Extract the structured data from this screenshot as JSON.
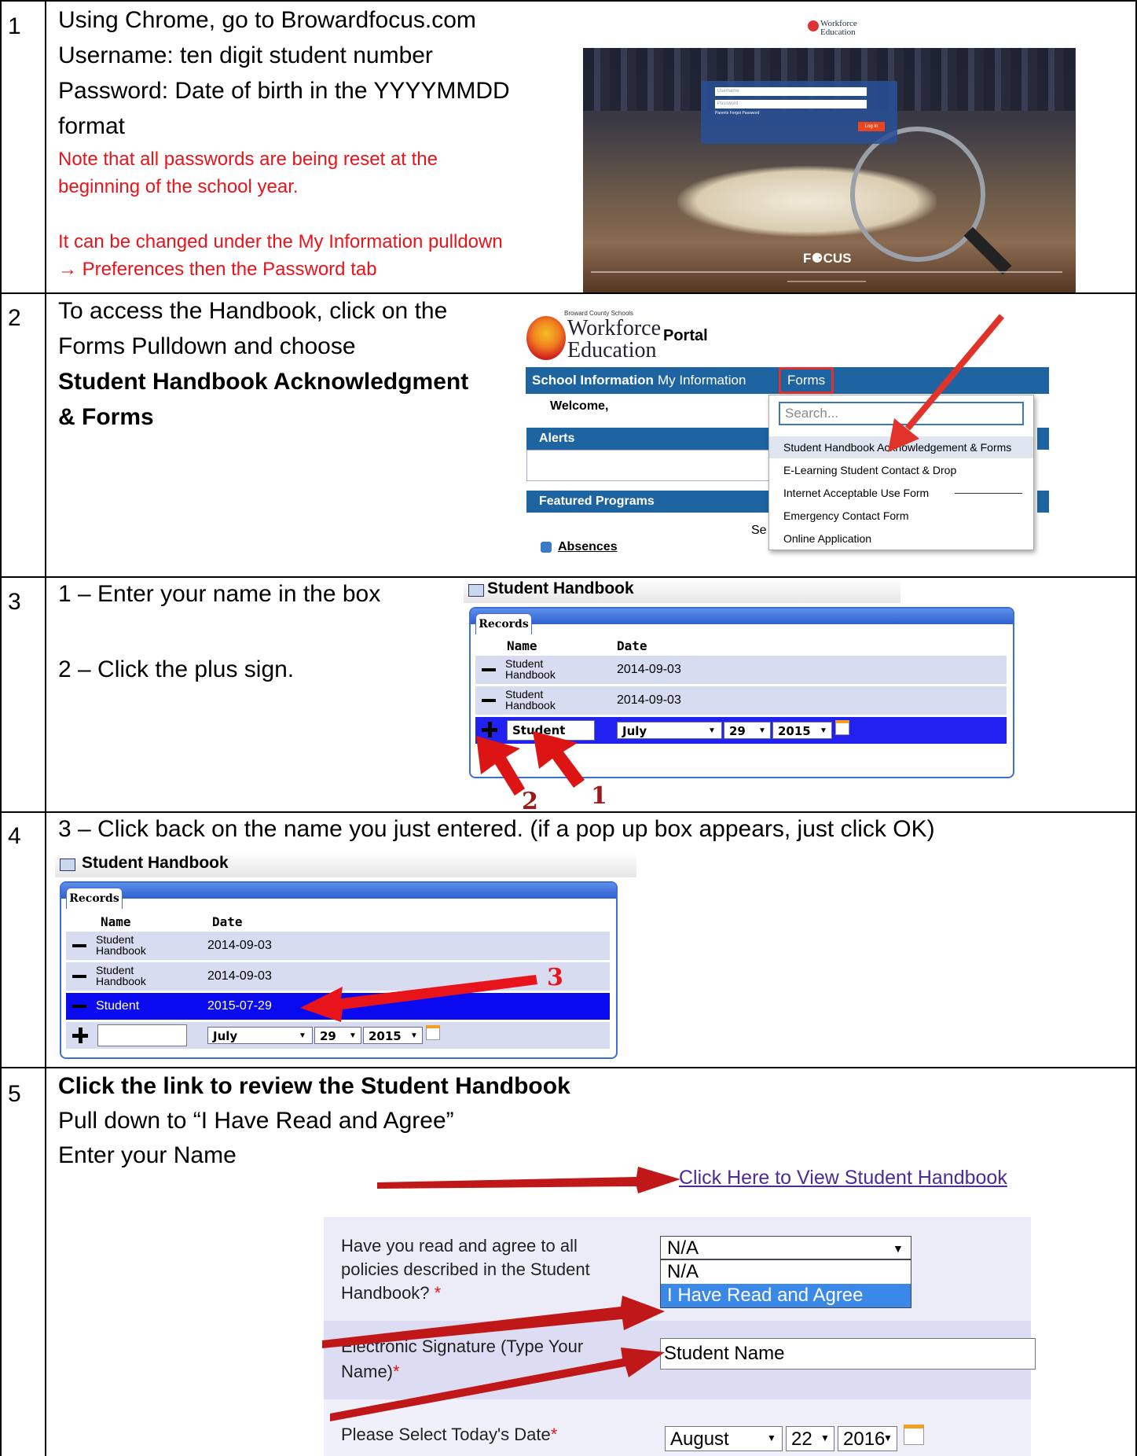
{
  "steps": [
    {
      "number": "1"
    },
    {
      "number": "2"
    },
    {
      "number": "3"
    },
    {
      "number": "4"
    },
    {
      "number": "5"
    }
  ],
  "step1": {
    "line1": "Using Chrome, go to Browardfocus.com",
    "line2": "Username: ten digit student number",
    "line3": "Password: Date of birth in the YYYYMMDD",
    "line4": "format",
    "note1": "Note that all passwords are being reset at the",
    "note2": "beginning of the school year.",
    "note3": "It can be changed under the My Information pulldown",
    "note4": "→ Preferences then the Password tab",
    "login": {
      "logo1": "Workforce",
      "logo2": "Education",
      "username_placeholder": "Username",
      "password_placeholder": "Password",
      "forgot": "Parents Forgot Password",
      "login_button": "Log In",
      "brand": "F⚈CUS"
    }
  },
  "step2": {
    "line1": "To access the Handbook, click on the",
    "line2": "Forms Pulldown and choose",
    "bold1": "Student Handbook Acknowledgment",
    "bold2": "& Forms",
    "portal": {
      "org": "Broward County Schools",
      "logo1": "Workforce",
      "logo2": "Education",
      "portal_label": "Portal",
      "nav": [
        "School Information",
        "My Information",
        "Forms"
      ],
      "welcome": "Welcome,",
      "alerts": "Alerts",
      "featured": "Featured Programs",
      "absences": "Absences",
      "partial": "Se",
      "search_placeholder": "Search...",
      "menu": [
        "Student Handbook Acknowledgement & Forms",
        "E-Learning Student Contact & Drop",
        "Internet Acceptable Use Form",
        "Emergency Contact Form",
        "Online Application"
      ]
    }
  },
  "step3": {
    "line1": "1 – Enter your name in the box",
    "line2": "2 – Click the plus sign.",
    "title": "Student Handbook",
    "tab": "Records",
    "col_name": "Name",
    "col_date": "Date",
    "rows": [
      {
        "name1": "Student",
        "name2": "Handbook",
        "date": "2014-09-03"
      },
      {
        "name1": "Student",
        "name2": "Handbook",
        "date": "2014-09-03"
      }
    ],
    "input_value": "Student",
    "month": "July",
    "day": "29",
    "year": "2015",
    "marker1": "1",
    "marker2": "2"
  },
  "step4": {
    "line1": "3 – Click back on the name you just entered.  (if a pop up box appears, just click OK)",
    "title": "Student Handbook",
    "tab": "Records",
    "col_name": "Name",
    "col_date": "Date",
    "rows": [
      {
        "name1": "Student",
        "name2": "Handbook",
        "date": "2014-09-03"
      },
      {
        "name1": "Student",
        "name2": "Handbook",
        "date": "2014-09-03"
      }
    ],
    "selected_name": "Student",
    "selected_date": "2015-07-29",
    "month": "July",
    "day": "29",
    "year": "2015",
    "marker3": "3"
  },
  "step5": {
    "bold1": "Click the link to review the Student Handbook",
    "line2": "Pull down to “I Have Read and Agree”",
    "line3": "Enter your Name",
    "link": "Click Here to View Student Handbook",
    "q1a": "Have you read and agree to all",
    "q1b": "policies described in the Student",
    "q1c": "Handbook?",
    "select_value": "N/A",
    "options": [
      "N/A",
      "I Have Read and Agree"
    ],
    "q2a": "Electronic Signature (Type Your",
    "q2b": "Name)",
    "signature_value": "Student Name",
    "q3": "Please Select Today's Date",
    "date_month": "August",
    "date_day": "22",
    "date_year": "2016",
    "required": "*"
  },
  "colors": {
    "red_note": "#e8141b",
    "portal_blue": "#1e64a0",
    "highlight": "#2222f0",
    "arrow": "#e0332a"
  }
}
